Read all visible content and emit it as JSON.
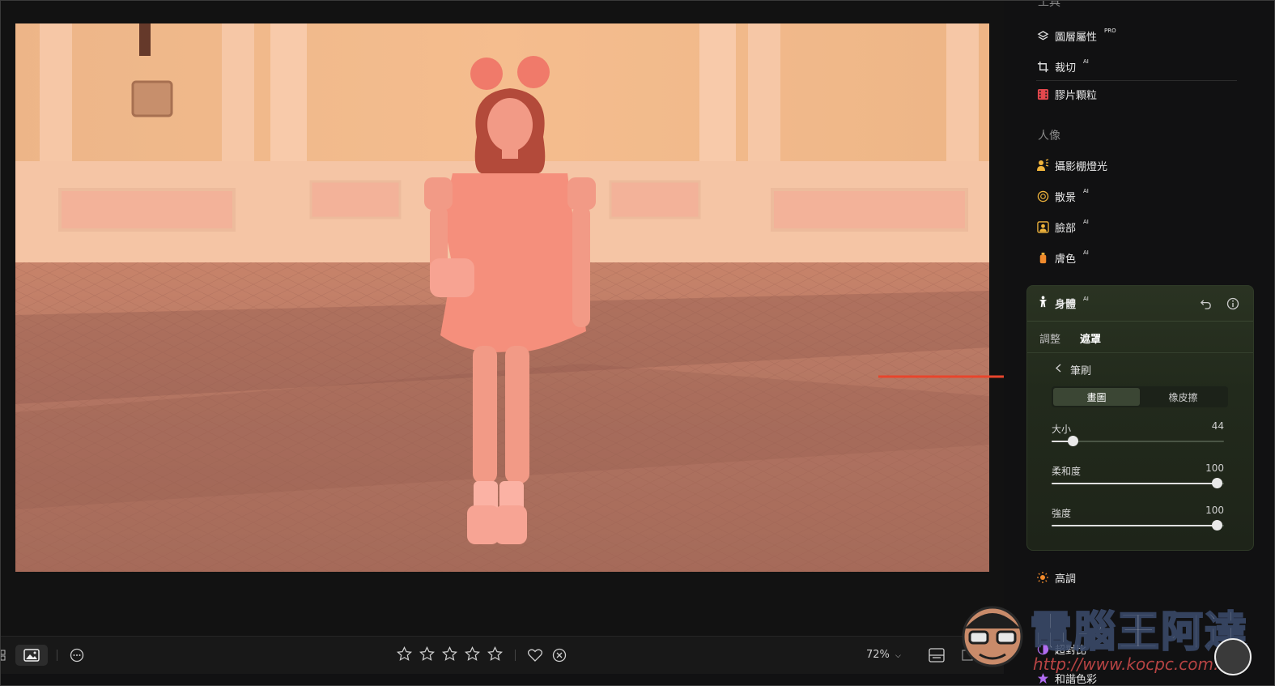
{
  "sidebar": {
    "top_section_partial": "工具",
    "tools": [
      {
        "label": "圖層屬性",
        "badge": "PRO",
        "icon": "layers-icon"
      },
      {
        "label": "裁切",
        "badge": "AI",
        "icon": "crop-icon"
      },
      {
        "label": "膠片顆粒",
        "badge": "",
        "icon": "film-grain-icon"
      }
    ],
    "portrait_header": "人像",
    "portrait_tools": [
      {
        "label": "攝影棚燈光",
        "badge": "",
        "icon": "studio-light-icon"
      },
      {
        "label": "散景",
        "badge": "AI",
        "icon": "bokeh-icon"
      },
      {
        "label": "臉部",
        "badge": "AI",
        "icon": "face-icon"
      },
      {
        "label": "膚色",
        "badge": "AI",
        "icon": "skin-tone-icon"
      }
    ],
    "body_panel": {
      "title": "身體",
      "badge": "AI",
      "tabs": [
        {
          "label": "調整",
          "active": false
        },
        {
          "label": "遮罩",
          "active": true
        }
      ],
      "back_label": "筆刷",
      "segments": [
        {
          "label": "畫圖",
          "active": true
        },
        {
          "label": "橡皮擦",
          "active": false
        }
      ],
      "sliders": [
        {
          "label": "大小",
          "value": "44",
          "fraction": 0.12
        },
        {
          "label": "柔和度",
          "value": "100",
          "fraction": 0.96
        },
        {
          "label": "強度",
          "value": "100",
          "fraction": 0.96
        }
      ]
    },
    "more_tools": [
      {
        "label": "高調",
        "badge": "",
        "icon": "high-key-icon"
      },
      {
        "label": "超對比",
        "badge": "",
        "icon": "super-contrast-icon"
      },
      {
        "label": "和諧色彩",
        "badge": "",
        "icon": "color-harmony-icon"
      }
    ]
  },
  "bottom_bar": {
    "zoom": "72%",
    "rating_stars": 5,
    "rating_value": 0
  },
  "watermark": {
    "text": "電腦王阿達",
    "url": "http://www.kocpc.com.tw"
  },
  "colors": {
    "accent_arrow": "#e8452c",
    "mask_overlay": "#ff5a3c",
    "panel_bg": "#252d1e"
  }
}
